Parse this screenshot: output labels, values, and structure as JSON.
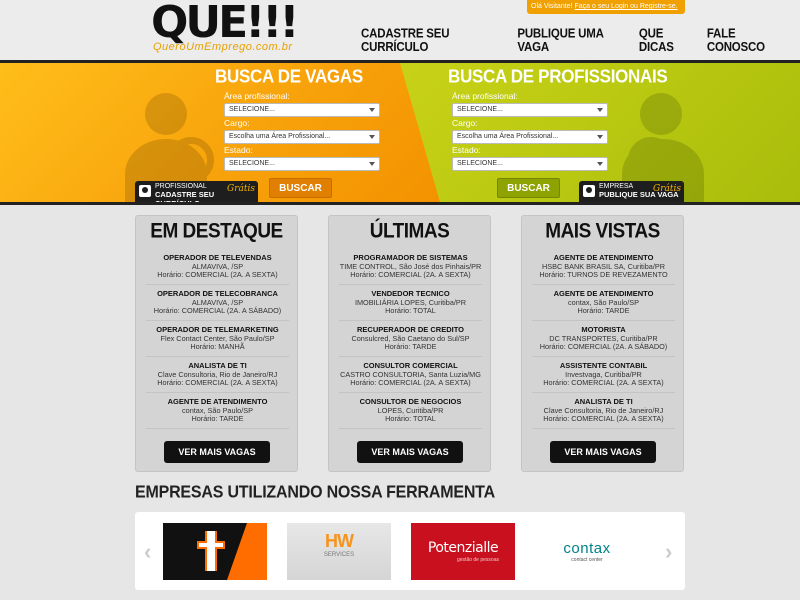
{
  "header": {
    "logo_main": "QUE!!!",
    "logo_sub": "QueroUmEmprego.com.br",
    "visitor_greeting": "Olá Visitante!",
    "login_link": "Faça o seu Login ou Registre-se.",
    "nav": [
      "CADASTRE SEU CURRÍCULO",
      "PUBLIQUE UMA VAGA",
      "QUE DICAS",
      "FALE CONOSCO"
    ]
  },
  "hero": {
    "left": {
      "title": "BUSCA DE VAGAS",
      "area_label": "Área profissional:",
      "area_value": "SELECIONE...",
      "cargo_label": "Cargo:",
      "cargo_value": "Escolha uma Área Profissional...",
      "estado_label": "Estado:",
      "estado_value": "SELECIONE...",
      "button": "BUSCAR",
      "promo_top": "PROFISSIONAL",
      "promo_bottom": "CADASTRE SEU CURRÍCULO",
      "promo_badge": "Grátis"
    },
    "right": {
      "title": "BUSCA DE PROFISSIONAIS",
      "area_label": "Área profissional:",
      "area_value": "SELECIONE...",
      "cargo_label": "Cargo:",
      "cargo_value": "Escolha uma Área Profissional...",
      "estado_label": "Estado:",
      "estado_value": "SELECIONE...",
      "button": "BUSCAR",
      "promo_top": "EMPRESA",
      "promo_bottom": "PUBLIQUE SUA VAGA",
      "promo_badge": "Grátis"
    }
  },
  "columns": [
    {
      "title": "EM DESTAQUE",
      "button": "VER MAIS VAGAS",
      "items": [
        {
          "title": "OPERADOR DE TELEVENDAS",
          "company": "ALMAVIVA, /SP",
          "hours": "Horário: COMERCIAL (2A. A SEXTA)"
        },
        {
          "title": "OPERADOR DE TELECOBRANCA",
          "company": "ALMAVIVA, /SP",
          "hours": "Horário: COMERCIAL (2A. A SÁBADO)"
        },
        {
          "title": "OPERADOR DE TELEMARKETING",
          "company": "Flex Contact Center, São Paulo/SP",
          "hours": "Horário: MANHÃ"
        },
        {
          "title": "ANALISTA DE TI",
          "company": "Clave Consultoria, Rio de Janeiro/RJ",
          "hours": "Horário: COMERCIAL (2A. A SEXTA)"
        },
        {
          "title": "AGENTE DE ATENDIMENTO",
          "company": "contax, São Paulo/SP",
          "hours": "Horário: TARDE"
        }
      ]
    },
    {
      "title": "ÚLTIMAS",
      "button": "VER MAIS VAGAS",
      "items": [
        {
          "title": "PROGRAMADOR DE SISTEMAS",
          "company": "TIME CONTROL, São José dos Pinhais/PR",
          "hours": "Horário: COMERCIAL (2A. A SEXTA)"
        },
        {
          "title": "VENDEDOR TECNICO",
          "company": "IMOBILIÁRIA LOPES, Curitiba/PR",
          "hours": "Horário: TOTAL"
        },
        {
          "title": "RECUPERADOR DE CREDITO",
          "company": "Consulcred, São Caetano do Sul/SP",
          "hours": "Horário: TARDE"
        },
        {
          "title": "CONSULTOR COMERCIAL",
          "company": "CASTRO CONSULTORIA, Santa Luzia/MG",
          "hours": "Horário: COMERCIAL (2A. A SEXTA)"
        },
        {
          "title": "CONSULTOR DE NEGOCIOS",
          "company": "LOPES, Curitiba/PR",
          "hours": "Horário: TOTAL"
        }
      ]
    },
    {
      "title": "MAIS VISTAS",
      "button": "VER MAIS VAGAS",
      "items": [
        {
          "title": "AGENTE DE ATENDIMENTO",
          "company": "HSBC BANK BRASIL SA, Curitiba/PR",
          "hours": "Horário: TURNOS DE REVEZAMENTO"
        },
        {
          "title": "AGENTE DE ATENDIMENTO",
          "company": "contax, São Paulo/SP",
          "hours": "Horário: TARDE"
        },
        {
          "title": "MOTORISTA",
          "company": "DC TRANSPORTES, Curitiba/PR",
          "hours": "Horário: COMERCIAL (2A. A SÁBADO)"
        },
        {
          "title": "ASSISTENTE CONTABIL",
          "company": "Investvaga, Curitiba/PR",
          "hours": "Horário: COMERCIAL (2A. A SEXTA)"
        },
        {
          "title": "ANALISTA DE TI",
          "company": "Clave Consultoria, Rio de Janeiro/RJ",
          "hours": "Horário: COMERCIAL (2A. A SEXTA)"
        }
      ]
    }
  ],
  "companies": {
    "title": "EMPRESAS UTILIZANDO NOSSA FERRAMENTA",
    "prev_arrow": "‹",
    "next_arrow": "›",
    "logos": [
      {
        "name": "company-logo-1"
      },
      {
        "text": "HW",
        "sub": "SERVICES"
      },
      {
        "text": "Potenzialle",
        "sub": "gestão de pessoas"
      },
      {
        "text": "contax",
        "sub": "contact center"
      }
    ]
  },
  "colors": {
    "accent_orange": "#f7a10a",
    "accent_green": "#c2ce14",
    "dark": "#111111"
  }
}
